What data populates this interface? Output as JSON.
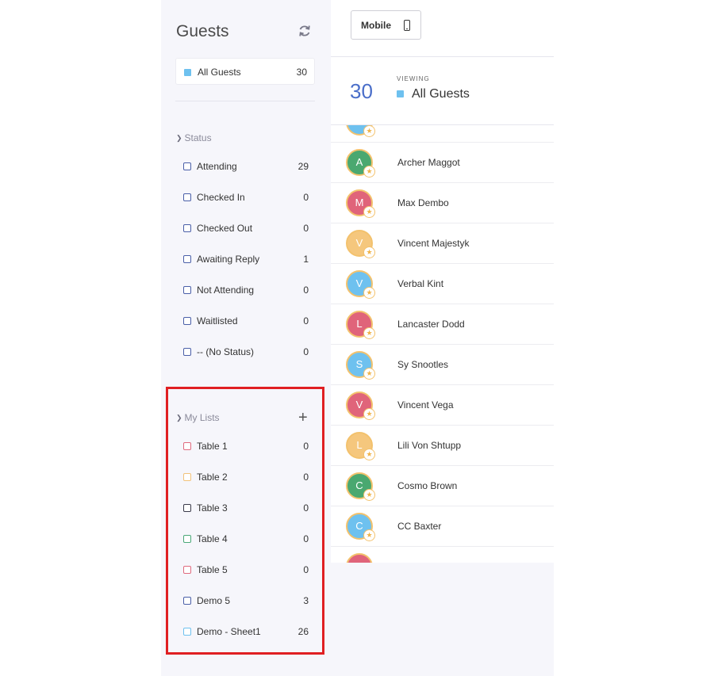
{
  "sidebar": {
    "title": "Guests",
    "refresh_icon": "refresh-icon",
    "all_guests": {
      "label": "All Guests",
      "count": "30",
      "color": "#6ec1ef"
    },
    "status": {
      "heading": "Status",
      "items": [
        {
          "label": "Attending",
          "count": "29"
        },
        {
          "label": "Checked In",
          "count": "0"
        },
        {
          "label": "Checked Out",
          "count": "0"
        },
        {
          "label": "Awaiting Reply",
          "count": "1"
        },
        {
          "label": "Not Attending",
          "count": "0"
        },
        {
          "label": "Waitlisted",
          "count": "0"
        },
        {
          "label": "-- (No Status)",
          "count": "0"
        }
      ]
    },
    "lists": {
      "heading": "My Lists",
      "add_label": "+",
      "items": [
        {
          "label": "Table 1",
          "count": "0",
          "color": "#e06b7f"
        },
        {
          "label": "Table 2",
          "count": "0",
          "color": "#f2c27a"
        },
        {
          "label": "Table 3",
          "count": "0",
          "color": "#3a3a4a"
        },
        {
          "label": "Table 4",
          "count": "0",
          "color": "#4aa878"
        },
        {
          "label": "Table 5",
          "count": "0",
          "color": "#e06b7f"
        },
        {
          "label": "Demo 5",
          "count": "3",
          "color": "#4a5fa8"
        },
        {
          "label": "Demo - Sheet1",
          "count": "26",
          "color": "#6ec1ef"
        }
      ]
    }
  },
  "header": {
    "mobile_label": "Mobile"
  },
  "viewing": {
    "count": "30",
    "caption": "VIEWING",
    "title": "All Guests"
  },
  "guests": [
    {
      "initial": "A",
      "name": "Archer Maggot",
      "color": "#4aa870"
    },
    {
      "initial": "M",
      "name": "Max Dembo",
      "color": "#e0647a"
    },
    {
      "initial": "V",
      "name": "Vincent Majestyk",
      "color": "#f5c77d"
    },
    {
      "initial": "V",
      "name": "Verbal Kint",
      "color": "#6ec1ef"
    },
    {
      "initial": "L",
      "name": "Lancaster Dodd",
      "color": "#e0647a"
    },
    {
      "initial": "S",
      "name": "Sy Snootles",
      "color": "#6ec1ef"
    },
    {
      "initial": "V",
      "name": "Vincent Vega",
      "color": "#e0647a"
    },
    {
      "initial": "L",
      "name": "Lili Von Shtupp",
      "color": "#f5c77d"
    },
    {
      "initial": "C",
      "name": "Cosmo Brown",
      "color": "#4aa870"
    },
    {
      "initial": "C",
      "name": "CC Baxter",
      "color": "#6ec1ef"
    }
  ]
}
